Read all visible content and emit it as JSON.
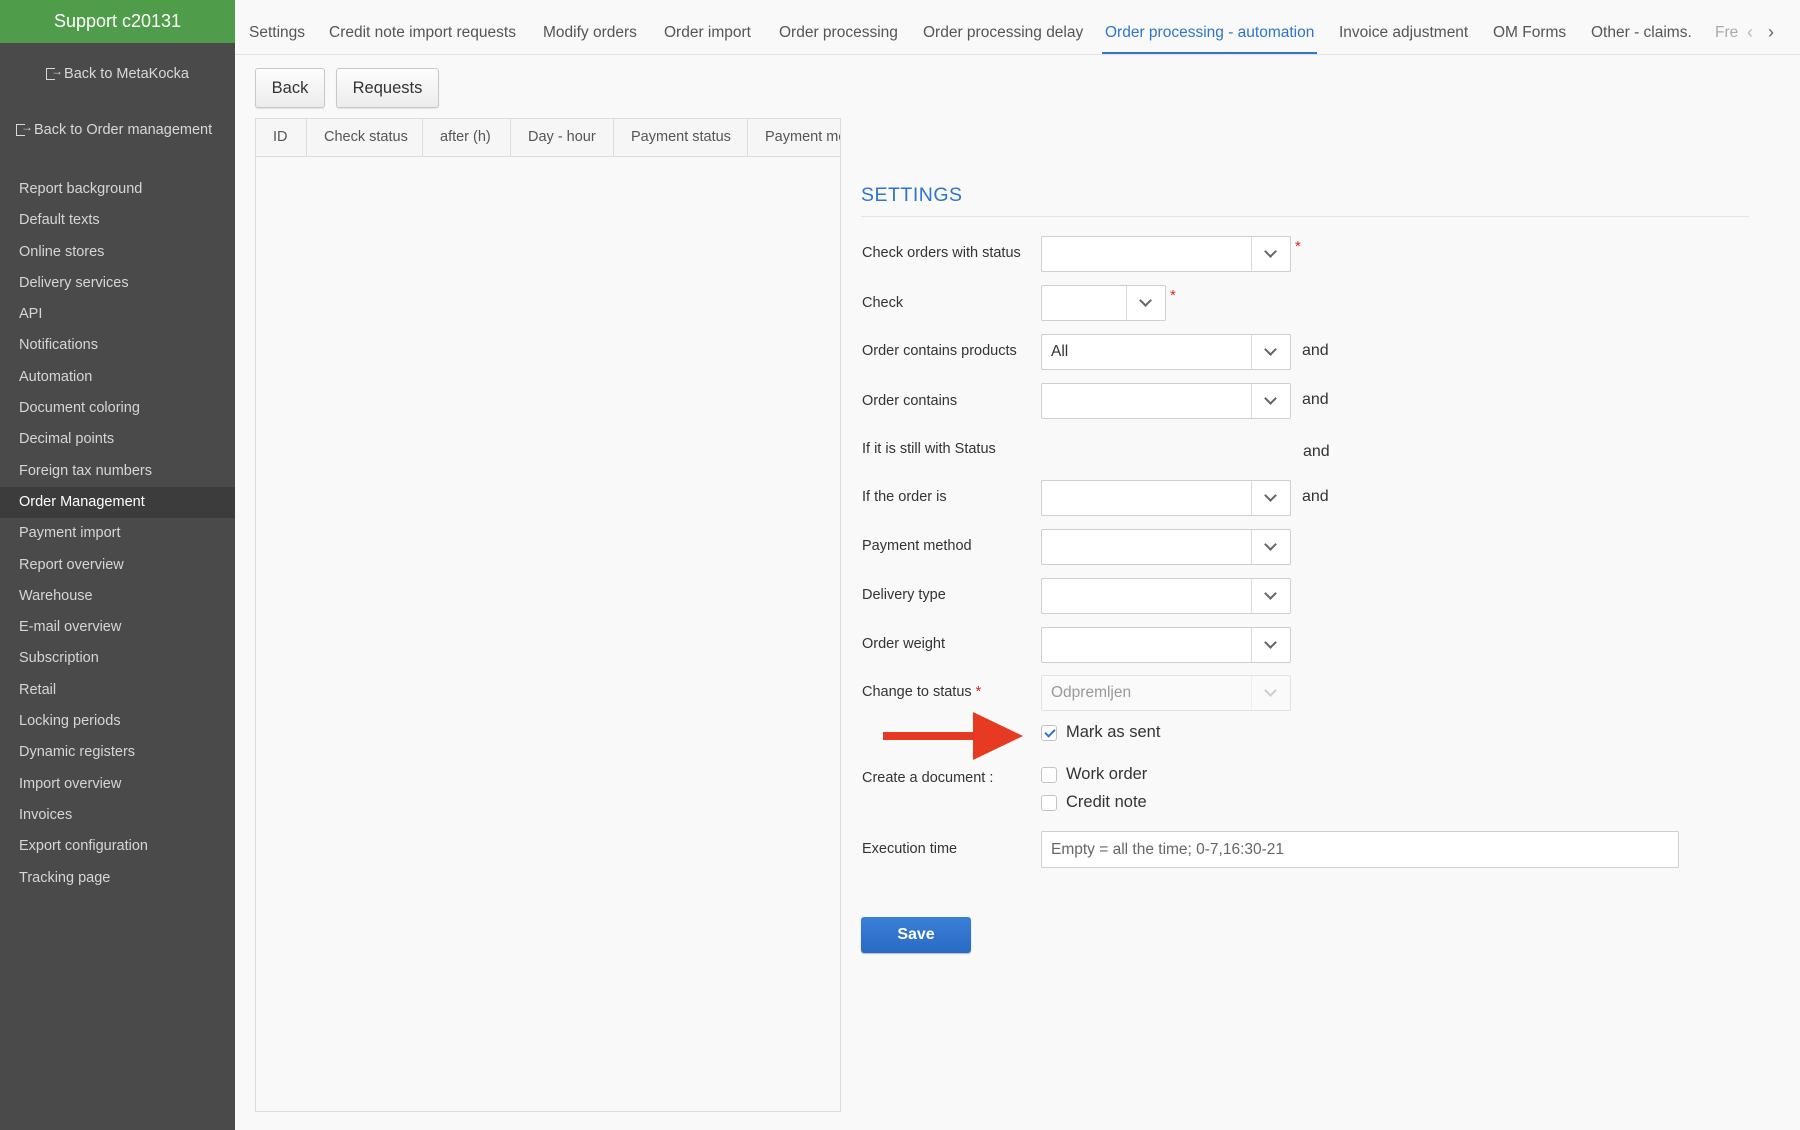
{
  "sidebar": {
    "title": "Support c20131",
    "back_metakocka": "Back to MetaKocka",
    "back_order_management": "Back to Order management",
    "items": [
      {
        "label": "Report background"
      },
      {
        "label": "Default texts"
      },
      {
        "label": "Online stores"
      },
      {
        "label": "Delivery services"
      },
      {
        "label": "API"
      },
      {
        "label": "Notifications"
      },
      {
        "label": "Automation"
      },
      {
        "label": "Document coloring"
      },
      {
        "label": "Decimal points"
      },
      {
        "label": "Foreign tax numbers"
      },
      {
        "label": "Order Management",
        "active": true
      },
      {
        "label": "Payment import"
      },
      {
        "label": "Report overview"
      },
      {
        "label": "Warehouse"
      },
      {
        "label": "E-mail overview"
      },
      {
        "label": "Subscription"
      },
      {
        "label": "Retail"
      },
      {
        "label": "Locking periods"
      },
      {
        "label": "Dynamic registers"
      },
      {
        "label": "Import overview"
      },
      {
        "label": "Invoices"
      },
      {
        "label": "Export configuration"
      },
      {
        "label": "Tracking page"
      }
    ]
  },
  "tabs": [
    {
      "label": "Settings"
    },
    {
      "label": "Credit note import requests"
    },
    {
      "label": "Modify orders"
    },
    {
      "label": "Order import"
    },
    {
      "label": "Order processing"
    },
    {
      "label": "Order processing delay"
    },
    {
      "label": "Order processing - automation",
      "active": true
    },
    {
      "label": "Invoice adjustment"
    },
    {
      "label": "OM Forms"
    },
    {
      "label": "Other - claims."
    },
    {
      "label": "Fre"
    }
  ],
  "toolbar": {
    "back_label": "Back",
    "requests_label": "Requests"
  },
  "grid": {
    "columns": [
      "ID",
      "Check status",
      "after (h)",
      "Day - hour",
      "Payment status",
      "Payment me"
    ]
  },
  "settings": {
    "title": "SETTINGS",
    "check_orders_with_status": {
      "label": "Check orders with status",
      "value": ""
    },
    "check": {
      "label": "Check",
      "value": ""
    },
    "order_contains_products": {
      "label": "Order contains products",
      "value": "All"
    },
    "order_contains": {
      "label": "Order contains",
      "value": ""
    },
    "if_still_with_status": {
      "label": "If it is still with Status"
    },
    "if_order_is": {
      "label": "If the order is",
      "value": ""
    },
    "payment_method": {
      "label": "Payment method",
      "value": ""
    },
    "delivery_type": {
      "label": "Delivery type",
      "value": ""
    },
    "order_weight": {
      "label": "Order weight",
      "value": ""
    },
    "change_to_status": {
      "label": "Change to status",
      "value": "Odpremljen"
    },
    "mark_as_sent": {
      "label": "Mark as sent",
      "checked": true
    },
    "create_document": {
      "label": "Create a document :",
      "work_order": "Work order",
      "credit_note": "Credit note"
    },
    "execution_time": {
      "label": "Execution time",
      "placeholder": "Empty = all the time; 0-7,16:30-21",
      "value": ""
    },
    "and_label": "and",
    "required_marker": "*",
    "save_label": "Save"
  },
  "colors": {
    "accent": "#2f75c9",
    "sidebar_header": "#4f9d4a",
    "annotation_arrow": "#e63a23"
  },
  "icons": {
    "back": "sign-out-icon",
    "dropdown": "chevron-down-icon",
    "scroll_left": "chevron-left-icon",
    "scroll_right": "chevron-right-icon"
  }
}
